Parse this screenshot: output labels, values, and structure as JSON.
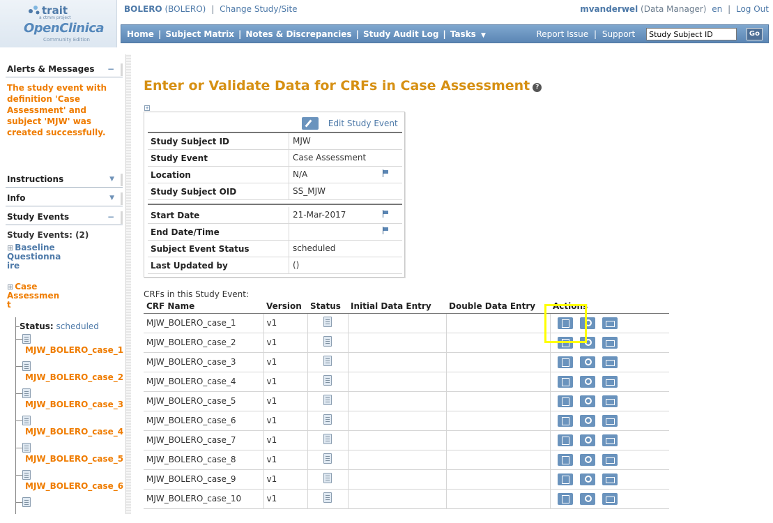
{
  "brand": {
    "trait": "trait",
    "trait_sub": "a ctmm project",
    "openclinica": "OpenClinica",
    "edition": "Community Edition"
  },
  "study_line": {
    "study": "BOLERO",
    "study_paren": "(BOLERO)",
    "separator": "|",
    "change": "Change Study/Site"
  },
  "user_line": {
    "username": "mvanderwel",
    "role": "(Data Manager)",
    "lang": "en",
    "separator": "|",
    "logout": "Log Out"
  },
  "nav": {
    "home": "Home",
    "subject_matrix": "Subject Matrix",
    "notes": "Notes & Discrepancies",
    "audit": "Study Audit Log",
    "tasks": "Tasks",
    "tasks_arrow": "▼",
    "separator": "|",
    "report_issue": "Report Issue",
    "support": "Support",
    "search_value": "Study Subject ID",
    "go": "Go"
  },
  "sidebar": {
    "alerts_title": "Alerts & Messages",
    "alerts_toggle": "−",
    "alert_message": "The study event with definition 'Case Assessment' and subject 'MJW' was created successfully.",
    "instructions_title": "Instructions",
    "instructions_toggle": "▼",
    "info_title": "Info",
    "info_toggle": "▼",
    "study_events_title": "Study Events",
    "study_events_toggle": "−",
    "study_events_count": "Study Events: (2)",
    "expand_glyph": "⊞",
    "events": [
      {
        "label_lines": [
          "Baseline",
          "Questionna",
          "ire"
        ]
      },
      {
        "label_lines": [
          "Case",
          "Assessmen",
          "t"
        ]
      }
    ],
    "status_label": "Status:",
    "status_value": "scheduled",
    "tree_crfs": [
      "MJW_BOLERO_case_1",
      "MJW_BOLERO_case_2",
      "MJW_BOLERO_case_3",
      "MJW_BOLERO_case_4",
      "MJW_BOLERO_case_5",
      "MJW_BOLERO_case_6"
    ]
  },
  "main": {
    "title": "Enter or Validate Data for CRFs in Case Assessment",
    "help_glyph": "?",
    "expand_glyph": "+",
    "edit_event_label": "Edit Study Event",
    "event_fields": [
      {
        "label": "Study Subject ID",
        "value": "MJW",
        "flag": false
      },
      {
        "label": "Study Event",
        "value": "Case Assessment",
        "flag": false
      },
      {
        "label": "Location",
        "value": "N/A",
        "flag": true
      },
      {
        "label": "Study Subject OID",
        "value": "SS_MJW",
        "flag": false
      },
      {
        "label": "Start Date",
        "value": "21-Mar-2017",
        "flag": true
      },
      {
        "label": "End Date/Time",
        "value": "",
        "flag": true
      },
      {
        "label": "Subject Event Status",
        "value": "scheduled",
        "flag": false
      },
      {
        "label": "Last Updated by",
        "value": "()",
        "flag": false
      }
    ],
    "crf_caption": "CRFs in this Study Event:",
    "crf_columns": [
      "CRF Name",
      "Version",
      "Status",
      "Initial Data Entry",
      "Double Data Entry",
      "Actions"
    ],
    "crf_rows": [
      {
        "name": "MJW_BOLERO_case_1",
        "version": "v1"
      },
      {
        "name": "MJW_BOLERO_case_2",
        "version": "v1"
      },
      {
        "name": "MJW_BOLERO_case_3",
        "version": "v1"
      },
      {
        "name": "MJW_BOLERO_case_4",
        "version": "v1"
      },
      {
        "name": "MJW_BOLERO_case_5",
        "version": "v1"
      },
      {
        "name": "MJW_BOLERO_case_6",
        "version": "v1"
      },
      {
        "name": "MJW_BOLERO_case_7",
        "version": "v1"
      },
      {
        "name": "MJW_BOLERO_case_8",
        "version": "v1"
      },
      {
        "name": "MJW_BOLERO_case_9",
        "version": "v1"
      },
      {
        "name": "MJW_BOLERO_case_10",
        "version": "v1"
      }
    ]
  },
  "colors": {
    "accent": "#d69013",
    "alert": "#ef7c00",
    "link": "#4d79a8",
    "nav": "#6a93bd",
    "highlight": "#ffff00"
  }
}
